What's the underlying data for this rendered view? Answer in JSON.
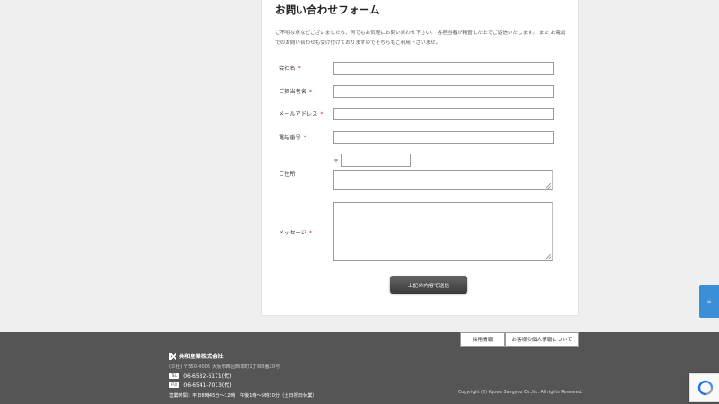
{
  "form": {
    "title": "お問い合わせフォーム",
    "intro": "ご不明な点などございましたら、何でもお気軽にお問い合わせ下さい。 各担当者が精査した上でご返信いたします。 また お電話でのお問い合わせも受け付けておりますのでそちらもご利用下さいませ。",
    "required_mark": "*",
    "fields": {
      "company": {
        "label": "会社名"
      },
      "contact_name": {
        "label": "ご担当者名"
      },
      "email": {
        "label": "メールアドレス"
      },
      "phone": {
        "label": "電話番号"
      },
      "address": {
        "label": "ご住所",
        "postal_mark": "〒"
      },
      "message": {
        "label": "メッセージ"
      }
    },
    "submit_label": "上記の内容で送信"
  },
  "footer": {
    "links": [
      "採用情報",
      "お客様の個人情報について"
    ],
    "company_name": "共和産業株式会社",
    "address": "(本社) 〒550-0005 大阪市西区西本町1丁目8番20号",
    "tel_tag": "TEL",
    "tel": "06-6532-6171(代)",
    "fax_tag": "FAX",
    "fax": "06-6541-7013(代)",
    "hours": "営業時間：平日8時45分〜12時　午後1時〜5時30分（土日祝日休業）",
    "copyright": "Copyright (C) Kyowa Sangyou Co.,ltd. All rights Reserved."
  },
  "side_tab_label": "≡",
  "colors": {
    "footer_bg": "#555555",
    "button_bg": "#444444",
    "side_tab": "#3a8fd6"
  }
}
